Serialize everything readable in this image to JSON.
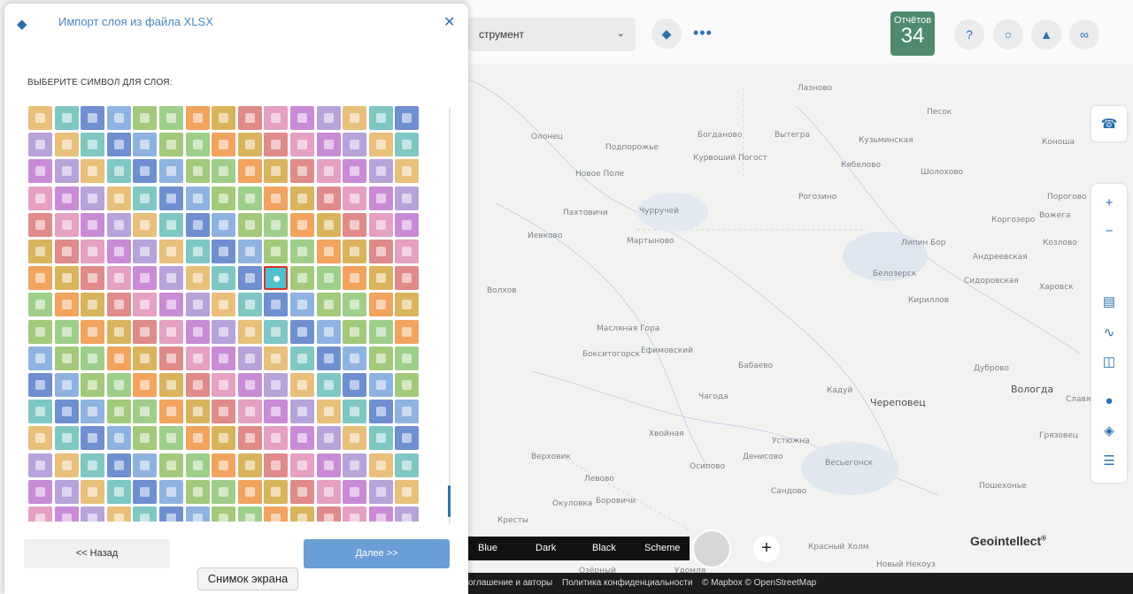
{
  "dialog": {
    "title": "Импорт слоя из файла XLSX",
    "section_label": "ВЫБЕРИТЕ СИМВОЛ ДЛЯ СЛОЯ:",
    "back_label": "<< Назад",
    "next_label": "Далее >>",
    "selected_symbol_row": 6,
    "selected_symbol_col": 9
  },
  "tooltip": "Снимок экрана",
  "toolbar": {
    "tool_select_value": "струмент",
    "reports_label": "Отчётов",
    "reports_count": "34"
  },
  "map": {
    "towns": [
      {
        "name": "Олонец"
      },
      {
        "name": "Подпорожье"
      },
      {
        "name": "Богданово"
      },
      {
        "name": "Вытегра"
      },
      {
        "name": "Кузьминская"
      },
      {
        "name": "Кябелово"
      },
      {
        "name": "Коноша"
      },
      {
        "name": "Новое Поле"
      },
      {
        "name": "Курвоший Погост"
      },
      {
        "name": "Рогозино"
      },
      {
        "name": "Пахтовичи"
      },
      {
        "name": "Чурручей"
      },
      {
        "name": "Иевково"
      },
      {
        "name": "Мартыново"
      },
      {
        "name": "Липин Бор"
      },
      {
        "name": "Андреевская"
      },
      {
        "name": "Белозерск"
      },
      {
        "name": "Сидоровская"
      },
      {
        "name": "Харовск"
      },
      {
        "name": "Волхов"
      },
      {
        "name": "Кириллов"
      },
      {
        "name": "Масляная Гора"
      },
      {
        "name": "Ефимовский"
      },
      {
        "name": "Бокситогорск"
      },
      {
        "name": "Бабаево"
      },
      {
        "name": "Дуброво"
      },
      {
        "name": "Кадуй"
      },
      {
        "name": "Череповец"
      },
      {
        "name": "Вологда"
      },
      {
        "name": "Чагода"
      },
      {
        "name": "Хвойная"
      },
      {
        "name": "Устюжна"
      },
      {
        "name": "Денисово"
      },
      {
        "name": "Весьегонск"
      },
      {
        "name": "Верховик"
      },
      {
        "name": "Осипово"
      },
      {
        "name": "Сандово"
      },
      {
        "name": "Пошехонье"
      },
      {
        "name": "Грязовец"
      },
      {
        "name": "Окуловка"
      },
      {
        "name": "Боровичи"
      },
      {
        "name": "Кресты"
      },
      {
        "name": "Красный Холм"
      },
      {
        "name": "Новый Некоуз"
      },
      {
        "name": "Тутаев"
      },
      {
        "name": "Лазново"
      },
      {
        "name": "Песок"
      },
      {
        "name": "Порогово"
      },
      {
        "name": "Коргозеро"
      },
      {
        "name": "Вожега"
      },
      {
        "name": "Козлово"
      },
      {
        "name": "Шолохово"
      },
      {
        "name": "Удомля"
      },
      {
        "name": "Озёрный"
      },
      {
        "name": "Славяне"
      },
      {
        "name": "Левово"
      }
    ]
  },
  "map_styles": [
    "Blue",
    "Dark",
    "Black",
    "Scheme"
  ],
  "brand": "Geointellect",
  "footer": {
    "agreement": "оглашение и авторы",
    "privacy": "Политика конфиденциальности",
    "attribution": "© Mapbox © OpenStreetMap"
  },
  "colors": {
    "accent": "#2c6fb0",
    "next_button": "#6b9ed6",
    "reports_badge": "#4d8a6e",
    "selection": "#d9322b"
  },
  "icons": [
    "layers-icon",
    "close-icon",
    "chevron-down-icon",
    "more-icon",
    "help-icon",
    "search-icon",
    "notify-icon",
    "link-icon",
    "phone-icon",
    "zoom-in-icon",
    "zoom-out-icon",
    "chart-icon",
    "graph-icon",
    "compare-icon",
    "pin-icon",
    "eraser-icon",
    "stack-icon"
  ]
}
